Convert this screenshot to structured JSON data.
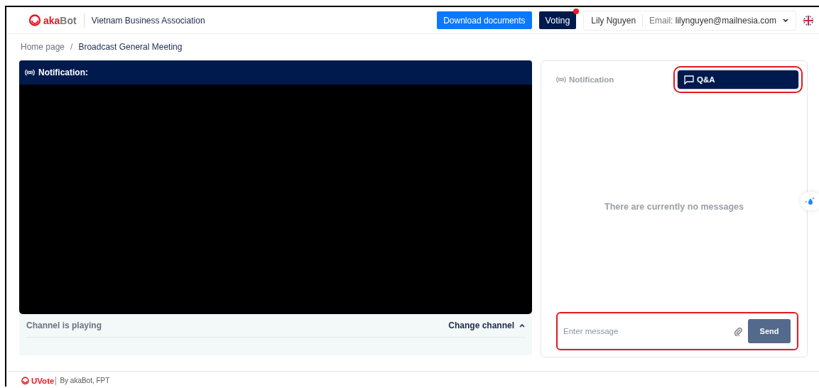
{
  "header": {
    "brand": "akaBot",
    "organization": "Vietnam Business Association",
    "download_button": "Download documents",
    "voting_button": {
      "label": "Voting",
      "alert": true
    },
    "user_name": "Lily Nguyen",
    "email_label": "Email:",
    "email": "lilynguyen@mailnesia.com"
  },
  "breadcrumb": {
    "separator": "/",
    "items": [
      "Home page",
      "Broadcast General Meeting"
    ]
  },
  "video": {
    "header": "Notification:",
    "status": "Channel is playing",
    "change_channel": "Change channel"
  },
  "chat": {
    "tabs": [
      {
        "label": "Notification",
        "kind": "broadcast",
        "selected": false
      },
      {
        "label": "Q&A",
        "kind": "message",
        "selected": true
      }
    ],
    "empty_text": "There are currently no messages",
    "input": {
      "placeholder": "Enter message"
    },
    "send_button": "Send"
  },
  "footer": {
    "brand": "UVote",
    "credit": "By akaBot, FPT"
  }
}
